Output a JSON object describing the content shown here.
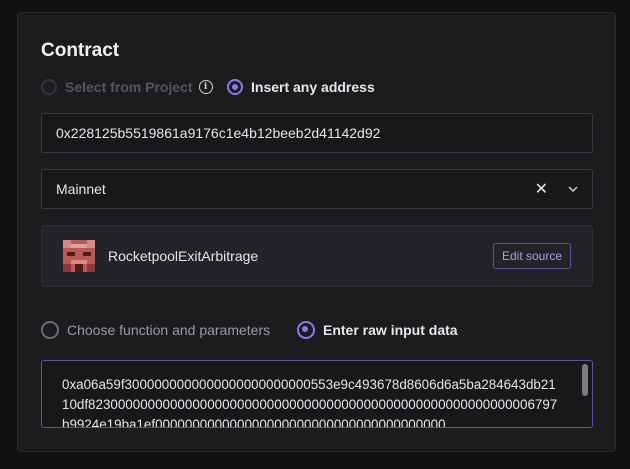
{
  "section_title": "Contract",
  "address_mode": {
    "select_from_project": "Select from Project",
    "insert_any_address": "Insert any address"
  },
  "address_input": {
    "value": "0x228125b5519861a9176c1e4b12beeb2d41142d92"
  },
  "network_select": {
    "value": "Mainnet"
  },
  "contract": {
    "name": "RocketpoolExitArbitrage",
    "edit_label": "Edit source"
  },
  "input_mode": {
    "choose_function": "Choose function and parameters",
    "enter_raw": "Enter raw input data"
  },
  "raw_input": {
    "value": "0xa06a59f3000000000000000000000000553e9c493678d8606d6a5ba284643db2110df823000000000000000000000000000000000000000000000000000000006797b9924e19ba1ef000000000000000000000000000000000000000"
  },
  "colors": {
    "accent": "#8b7be8",
    "background": "#1c1c1f"
  }
}
